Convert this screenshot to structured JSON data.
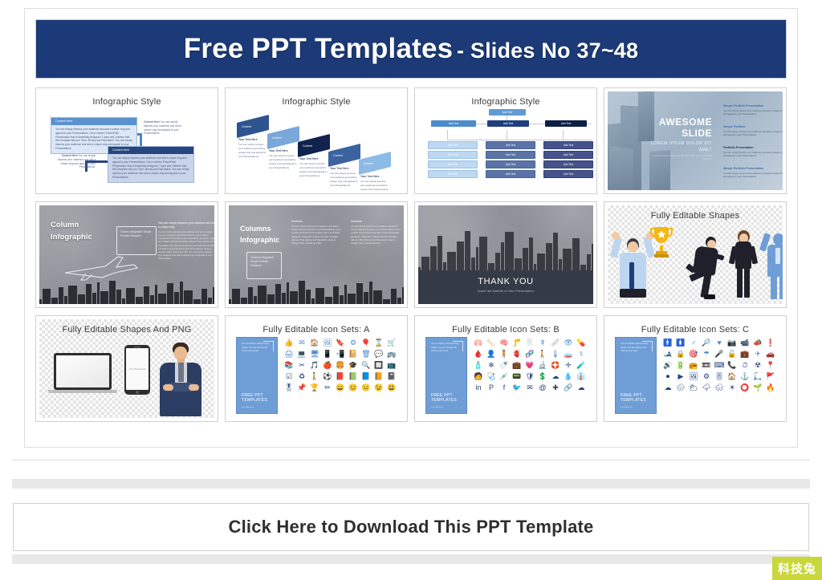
{
  "banner": {
    "main": "Free PPT Templates",
    "sub": "- Slides No 37~48",
    "bg_color": "#1b3a77"
  },
  "slides": [
    {
      "id": "infographic-style-flow",
      "title": "Infographic Style",
      "box1_header": "Content  Here",
      "box1_body": "You can simply impress your audience and add a unique zing and appeal to your Presentations. Get a modern PowerPoint Presentation that is beautifully designed. I hope and I believe that this Template will your Time, Money and Reputation. You can simply impress your audience and add a unique zing and appeal to your Presentations.",
      "box2_header": "Content  Here",
      "box2_body": "You can simply impress your audience and add a unique zing and appeal to your Presentations. Get a modern PowerPoint Presentation that is beautifully designed. I hope and I believe that this Template will your Time, Money and Reputation. You can simply impress your audience and add a unique zing and appeal to your Presentations.",
      "note1_title": "Content Here",
      "note1_body": "You can simply impress your audience and add a unique zing and appeal to your Presentations.",
      "note2_title": "Content Here",
      "note2_body": "You can simply impress your audience and add a unique zing and appeal to your Presentations."
    },
    {
      "id": "infographic-style-arrows",
      "title": "Infographic Style",
      "arrow_labels": [
        "Content",
        "Content",
        "Content",
        "Content",
        "Content"
      ],
      "text_title": "Your Text Here",
      "text_body": "You can simply impress your audience and add a unique zing and appeal to your Presentations."
    },
    {
      "id": "infographic-style-chart",
      "title": "Infographic Style",
      "box_label": "Add Text"
    },
    {
      "id": "awesome-slide",
      "title": "AWESOME SLIDE",
      "line1": "AWESOME",
      "line2": "SLIDE",
      "lorem": "LOREM IPSUM DOLOR SIT AMET",
      "lorem_sub": "Consectetur adipiscing elit sed do eiusmod tempor",
      "items": [
        {
          "title": "Simple Portfolio Presentation",
          "body": "You can simply impress your audience and add a unique zing and appeal to your Presentations."
        },
        {
          "title": "Simple Portfolio",
          "body": "You can simply impress your audience and add a unique zing and appeal to your Presentations."
        },
        {
          "title": "Portfolio Presentation",
          "body": "You can simply impress your audience and add a unique zing and appeal to your Presentations."
        },
        {
          "title": "Simple Portfolio Presentation",
          "body": "You can simply impress your audience and add a unique zing and appeal to your Presentations."
        }
      ]
    },
    {
      "id": "column-infographic",
      "title": "Column Infographic",
      "line1": "Column",
      "line2": "Infographic",
      "bubble": "Column Infographic Simple Portfolio Designed",
      "body_title": "You can simply impress your audience and add a unique zing",
      "body": "You can simply impress your audience and add a unique zing and appeal to your Presentations. Get a modern PowerPoint Presentation that is beautifully designed. I hope and I believe that this Template will your Time, Money and Reputation. You can simply impress your audience and add a unique zing and appeal to your Presentations. Easy to change colors, photos and Text. You can simply impress your audience and add a unique zing and appeal to your Presentations.",
      "body_end": "You can simply impress your audience and add a unique zing and appeal to your Presentations."
    },
    {
      "id": "columns-infographic",
      "title": "Columns Infographic",
      "line1": "Columns",
      "line2": "Infographic",
      "bubble": "Columns Infographic Simple Portfolio Designed",
      "col1_title": "Contents",
      "col1_body": "You can simply impress your audience and add a unique zing and appeal to your Presentations. Get a modern PowerPoint Presentation that is beautifully designed. I hope and I believe that this Template will your Time, Money and Reputation. Easy to change colors, photos and Text.",
      "col2_title": "Contents",
      "col2_body": "You can simply impress your audience and add a unique zing and appeal to your Presentations. Get a modern PowerPoint Presentation that is beautifully designed. I hope and I believe that this Template will your Time, Money and Reputation. Easy to change colors, photos and Text."
    },
    {
      "id": "thank-you",
      "title": "THANK YOU",
      "heading": "THANK YOU",
      "subtitle": "Insert the Subtitle of Your Presentation"
    },
    {
      "id": "fully-editable-shapes",
      "title": "Fully Editable Shapes"
    },
    {
      "id": "fully-editable-shapes-and-png",
      "title": "Fully Editable Shapes And PNG",
      "phone_text": "Your Picture Here"
    },
    {
      "id": "icon-sets-a",
      "title": "Fully Editable Icon Sets: A",
      "panel_body": "You can Resize without losing quality. You can Change Fill Color & Line Color.",
      "panel_brand": "FREE PPT TEMPLATES",
      "panel_url": "www.allppt.com",
      "icons": [
        "👍",
        "✉",
        "🏠",
        "🖼",
        "🔖",
        "⚙",
        "🎈",
        "⌛",
        "🛒",
        "🖨",
        "💻",
        "🖥",
        "📱",
        "📲",
        "📔",
        "🗑",
        "💬",
        "🚌",
        "📚",
        "✂",
        "🎵",
        "🍎",
        "🍔",
        "🎓",
        "🔍",
        "🔲",
        "📺",
        "☑",
        "♻",
        "🚶",
        "⚽",
        "📕",
        "📗",
        "📘",
        "📙",
        "📓",
        "🎖",
        "📌",
        "🏆",
        "✏",
        "😀",
        "😊",
        "😐",
        "😉",
        "😃"
      ]
    },
    {
      "id": "icon-sets-b",
      "title": "Fully Editable Icon Sets: B",
      "panel_body": "You can Resize without losing quality. You can Change Fill Color & Line Color.",
      "panel_brand": "FREE PPT TEMPLATES",
      "panel_url": "www.allppt.com",
      "icons": [
        "🫁",
        "🦴",
        "🧠",
        "🦵",
        "🦷",
        "☤",
        "🩹",
        "👁",
        "💊",
        "🩸",
        "👤",
        "🧍",
        "🫀",
        "🧬",
        "🚶",
        "🌡",
        "🧫",
        "⚕",
        "🧴",
        "❄",
        "🍼",
        "💼",
        "💗",
        "🔬",
        "🛟",
        "✛",
        "🧪",
        "🧑",
        "🩺",
        "💉",
        "📟",
        "🛡",
        "💲",
        "☁",
        "💧",
        "👔",
        "in",
        "P",
        "f",
        "🐦",
        "✉",
        "@",
        "✚",
        "🔗",
        "☁"
      ]
    },
    {
      "id": "icon-sets-c",
      "title": "Fully Editable Icon Sets: C",
      "panel_body": "You can Resize without losing quality. You can Change Fill Color & Line Color.",
      "panel_brand": "FREE PPT TEMPLATES",
      "panel_url": "www.allppt.com",
      "icons": [
        "🚹",
        "🚺",
        "♂",
        "🔎",
        "♥",
        "📷",
        "📹",
        "📣",
        "❗",
        "🎿",
        "🔒",
        "🎯",
        "☂",
        "🎤",
        "🔓",
        "💼",
        "✈",
        "🚗",
        "🔊",
        "🔋",
        "📻",
        "📼",
        "⌨",
        "📞",
        "⏱",
        "☢",
        "📍",
        "⏺",
        "▶",
        "🖼",
        "⚙",
        "🎚",
        "🏠",
        "⚓",
        "🛴",
        "🚩",
        "☁",
        "🌧",
        "🌥",
        "🌩",
        "🌨",
        "☀",
        "⭕",
        "🌱",
        "🔥"
      ]
    }
  ],
  "cta": {
    "label": "Click Here to Download This PPT Template"
  },
  "watermark": {
    "text": "科技兔",
    "bg_color": "#c9d63c"
  }
}
